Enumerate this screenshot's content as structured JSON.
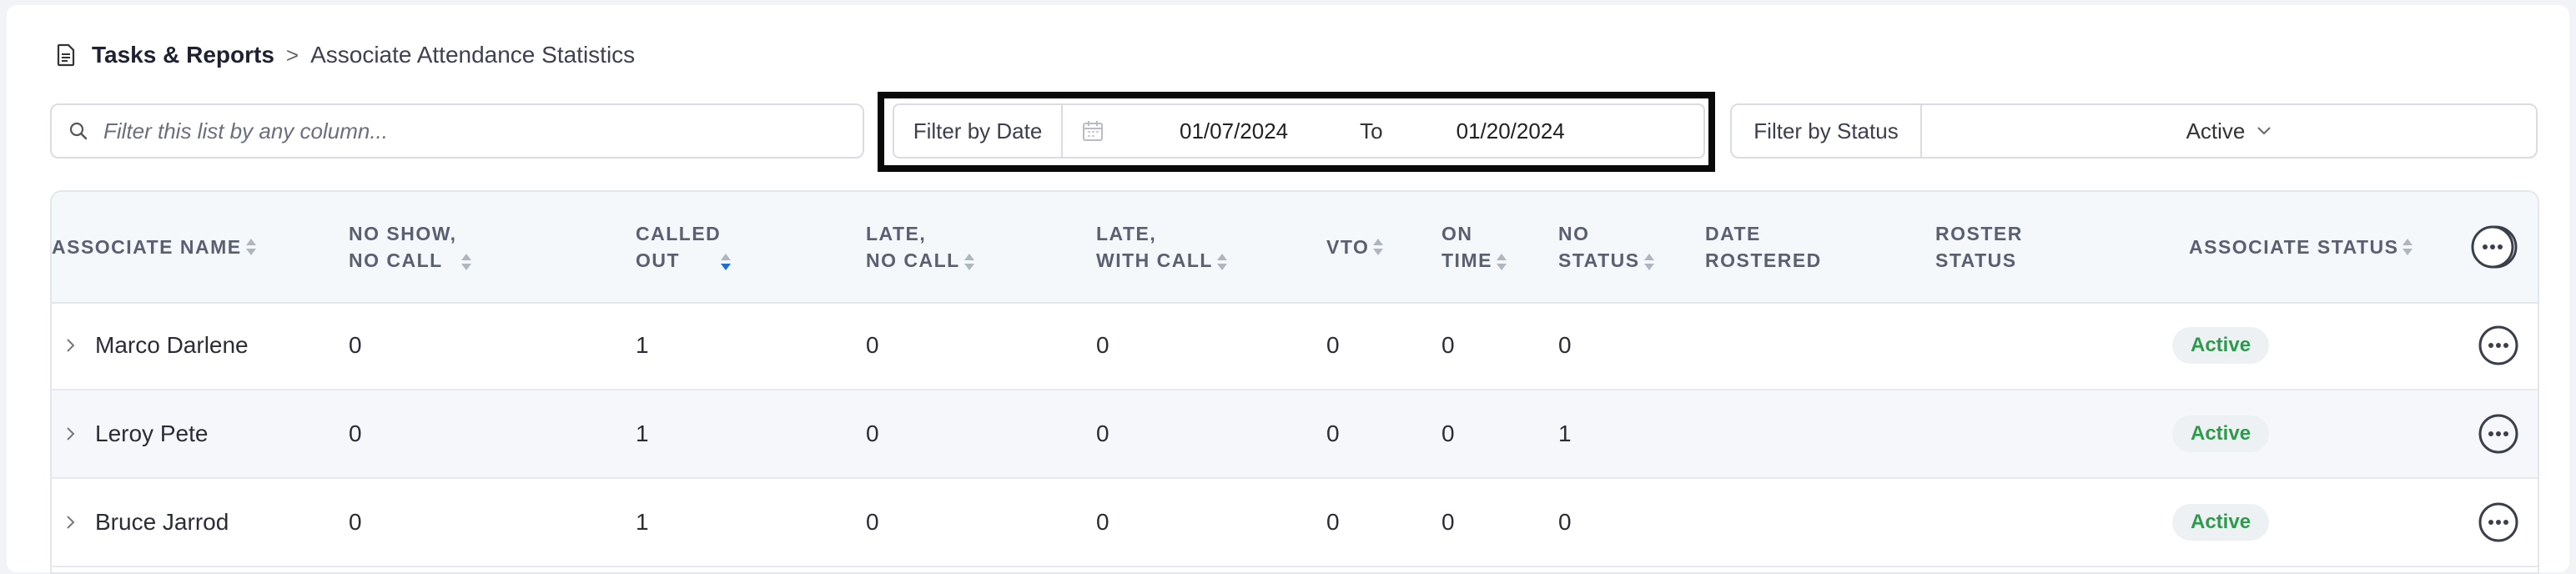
{
  "breadcrumb": {
    "root": "Tasks & Reports",
    "separator": ">",
    "current": "Associate Attendance Statistics",
    "icon": "document-icon"
  },
  "search": {
    "placeholder": "Filter this list by any column..."
  },
  "date_filter": {
    "label": "Filter by Date",
    "from": "01/07/2024",
    "to_label": "To",
    "to": "01/20/2024"
  },
  "status_filter": {
    "label": "Filter by Status",
    "value": "Active"
  },
  "table": {
    "headers": {
      "name": "ASSOCIATE NAME",
      "no_show_1": "NO SHOW,",
      "no_show_2": "NO CALL",
      "called_1": "CALLED",
      "called_2": "OUT",
      "late_nc_1": "LATE,",
      "late_nc_2": "NO CALL",
      "late_wc_1": "LATE,",
      "late_wc_2": "WITH CALL",
      "vto": "VTO",
      "on_time_1": "ON",
      "on_time_2": "TIME",
      "no_status_1": "NO",
      "no_status_2": "STATUS",
      "date_rostered_1": "DATE",
      "date_rostered_2": "ROSTERED",
      "roster_status_1": "ROSTER",
      "roster_status_2": "STATUS",
      "associate_status": "ASSOCIATE STATUS"
    },
    "rows": [
      {
        "name": "Marco Darlene",
        "no_show": "0",
        "called_out": "1",
        "late_no_call": "0",
        "late_with_call": "0",
        "vto": "0",
        "on_time": "0",
        "no_status": "0",
        "date_rostered": "",
        "roster_status": "",
        "status": "Active"
      },
      {
        "name": "Leroy Pete",
        "no_show": "0",
        "called_out": "1",
        "late_no_call": "0",
        "late_with_call": "0",
        "vto": "0",
        "on_time": "0",
        "no_status": "1",
        "date_rostered": "",
        "roster_status": "",
        "status": "Active"
      },
      {
        "name": "Bruce Jarrod",
        "no_show": "0",
        "called_out": "1",
        "late_no_call": "0",
        "late_with_call": "0",
        "vto": "0",
        "on_time": "0",
        "no_status": "0",
        "date_rostered": "",
        "roster_status": "",
        "status": "Active"
      }
    ]
  },
  "colors": {
    "active_badge_text": "#2e9a4c",
    "sort_active": "#1d6fd6",
    "highlight_border": "#0a0a0a"
  }
}
